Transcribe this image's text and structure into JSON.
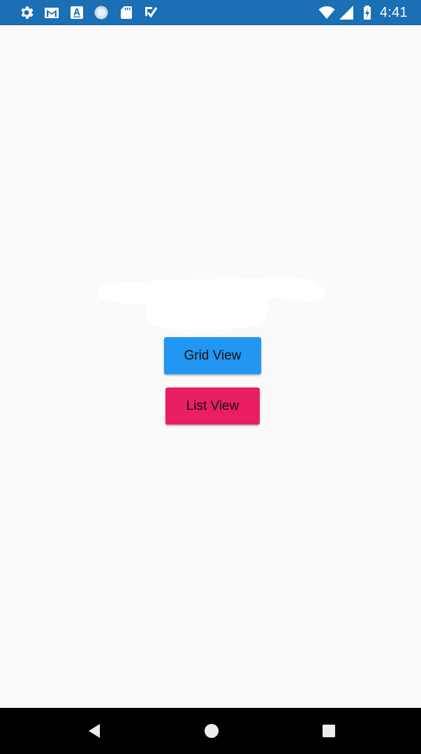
{
  "status_bar": {
    "background": "#1a6fb5",
    "time": "4:41",
    "notification_icons": [
      "gear-icon",
      "gmail-icon",
      "font-a-icon",
      "circle-dots-icon",
      "sd-card-icon",
      "checklist-icon"
    ],
    "system_icons": [
      "wifi-icon",
      "cell-signal-icon",
      "battery-charging-icon"
    ]
  },
  "main": {
    "buttons": [
      {
        "label": "Grid View",
        "color": "#2196f3"
      },
      {
        "label": "List View",
        "color": "#e91e63"
      }
    ]
  },
  "nav_bar": {
    "background": "#000000",
    "buttons": [
      "back-icon",
      "home-icon",
      "recents-icon"
    ]
  }
}
